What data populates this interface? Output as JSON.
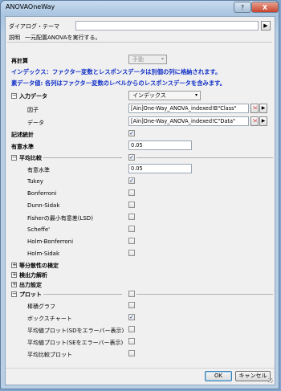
{
  "window": {
    "title": "ANOVAOneWay",
    "help_label": "?",
    "close_label": "X"
  },
  "dialog_theme": {
    "label": "ダイアログ・テーマ",
    "value": "",
    "button": "▶"
  },
  "description": {
    "label": "説明",
    "value": "一元配置ANOVAを実行する。"
  },
  "recalc": {
    "label": "再計算",
    "value": "手動"
  },
  "notes": {
    "line1": "インデックス：ファクター変数とレスポンスデータは別個の列に格納されます。",
    "line2": "素データ値: 各列はファクター変数のレベルからのレスポンスデータを含みます。"
  },
  "input_data": {
    "label": "入力データ",
    "mode": "インデックス",
    "factor_label": "因子",
    "factor_value": "[Ain]One-Way_ANOVA_indexed!B\"Class\"",
    "data_label": "データ",
    "data_value": "[Ain]One-Way_ANOVA_indexed!C\"Data\""
  },
  "descriptive": {
    "label": "記述統計",
    "checked": true
  },
  "significance": {
    "label": "有意水準",
    "value": "0.05"
  },
  "means_comparison": {
    "label": "平均比較",
    "sig_label": "有意水準",
    "sig_value": "0.05",
    "methods": [
      {
        "label": "Tukey",
        "checked": true
      },
      {
        "label": "Bonferroni",
        "checked": false
      },
      {
        "label": "Dunn-Sidak",
        "checked": false
      },
      {
        "label": "Fisherの最小有意差(LSD)",
        "checked": false
      },
      {
        "label": "Scheffe'",
        "checked": false
      },
      {
        "label": "Holm-Bonferroni",
        "checked": false
      },
      {
        "label": "Holm-Sidak",
        "checked": false
      }
    ]
  },
  "collapsed_sections": [
    "等分散性の検定",
    "検出力解析",
    "出力設定"
  ],
  "plots": {
    "label": "プロット",
    "items": [
      {
        "label": "棒積グラフ",
        "checked": false
      },
      {
        "label": "ボックスチャート",
        "checked": true
      },
      {
        "label": "平均値プロット(SDをエラーバー表示)",
        "checked": false
      },
      {
        "label": "平均値プロット(SEをエラーバー表示)",
        "checked": false
      },
      {
        "label": "平均比較プロット",
        "checked": false
      }
    ]
  },
  "buttons": {
    "ok": "OK",
    "cancel": "キャンセル"
  }
}
